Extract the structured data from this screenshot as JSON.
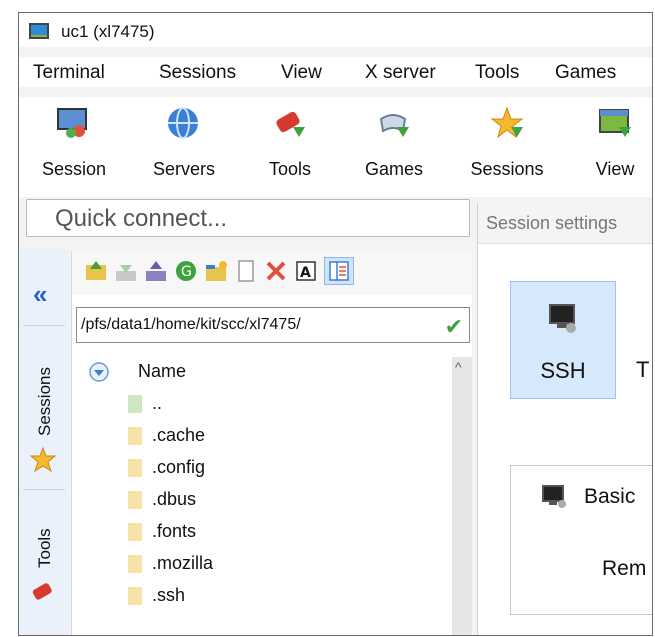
{
  "window": {
    "title": "uc1 (xl7475)"
  },
  "menu": [
    "Terminal",
    "Sessions",
    "View",
    "X server",
    "Tools",
    "Games"
  ],
  "toolbar": [
    {
      "label": "Session",
      "icon": "session-monitor-icon"
    },
    {
      "label": "Servers",
      "icon": "globe-icon"
    },
    {
      "label": "Tools",
      "icon": "swiss-knife-icon"
    },
    {
      "label": "Games",
      "icon": "gamepad-icon"
    },
    {
      "label": "Sessions",
      "icon": "star-icon"
    },
    {
      "label": "View",
      "icon": "view-window-icon"
    }
  ],
  "quick_connect": {
    "placeholder": "Quick connect..."
  },
  "side_tabs": [
    {
      "label": "Sessions",
      "icon": "star-icon"
    },
    {
      "label": "Tools",
      "icon": "swiss-knife-icon"
    }
  ],
  "file_browser": {
    "path": "/pfs/data1/home/kit/scc/xl7475/",
    "column_name": "Name",
    "items": [
      "..",
      ".cache",
      ".config",
      ".dbus",
      ".fonts",
      ".mozilla",
      ".ssh"
    ]
  },
  "session_settings": {
    "title": "Session settings",
    "ssh_label": "SSH",
    "next_label": "T",
    "basic_label": "Basic",
    "rem_label": "Rem"
  },
  "colors": {
    "accent": "#2a63c4",
    "selected_tile": "#d6e8fb",
    "folder": "#f5e3a9",
    "check": "#3da33d"
  }
}
